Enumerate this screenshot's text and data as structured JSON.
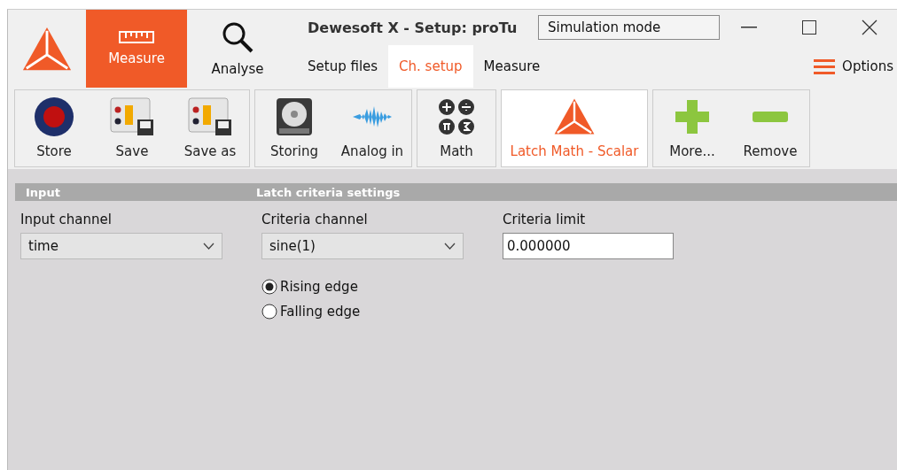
{
  "window": {
    "title": "Dewesoft X - Setup: proTu",
    "tooltip": "Simulation mode"
  },
  "modes": [
    {
      "label": "Measure",
      "kind": "ruler",
      "selected": true
    },
    {
      "label": "Analyse",
      "kind": "search",
      "selected": false
    }
  ],
  "nav_tabs": [
    {
      "label": "Setup files",
      "selected": false
    },
    {
      "label": "Ch. setup",
      "selected": true
    },
    {
      "label": "Measure",
      "selected": false
    }
  ],
  "options": "Options",
  "toolbar_groups": [
    {
      "buttons": [
        {
          "label": "Store",
          "kind": "record",
          "selected": false
        },
        {
          "label": "Save",
          "kind": "module",
          "selected": false
        },
        {
          "label": "Save as",
          "kind": "module",
          "selected": false
        }
      ]
    },
    {
      "buttons": [
        {
          "label": "Storing",
          "kind": "disk",
          "selected": false
        },
        {
          "label": "Analog in",
          "kind": "wave",
          "selected": false
        }
      ]
    },
    {
      "buttons": [
        {
          "label": "Math",
          "kind": "math",
          "selected": false
        }
      ]
    },
    {
      "buttons": [
        {
          "label": "Latch Math - Scalar",
          "kind": "logo",
          "selected": true
        }
      ]
    },
    {
      "buttons": [
        {
          "label": "More...",
          "kind": "plus",
          "selected": false
        },
        {
          "label": "Remove",
          "kind": "minus",
          "selected": false
        }
      ]
    }
  ],
  "section_headers": [
    "Input",
    "Latch criteria settings"
  ],
  "input_channel": {
    "label": "Input channel",
    "value": "time"
  },
  "criteria_channel": {
    "label": "Criteria channel",
    "value": "sine(1)"
  },
  "edge_options": [
    {
      "label": "Rising edge",
      "selected": true
    },
    {
      "label": "Falling edge",
      "selected": false
    }
  ],
  "criteria_limit": {
    "label": "Criteria limit",
    "value": "0.000000"
  }
}
